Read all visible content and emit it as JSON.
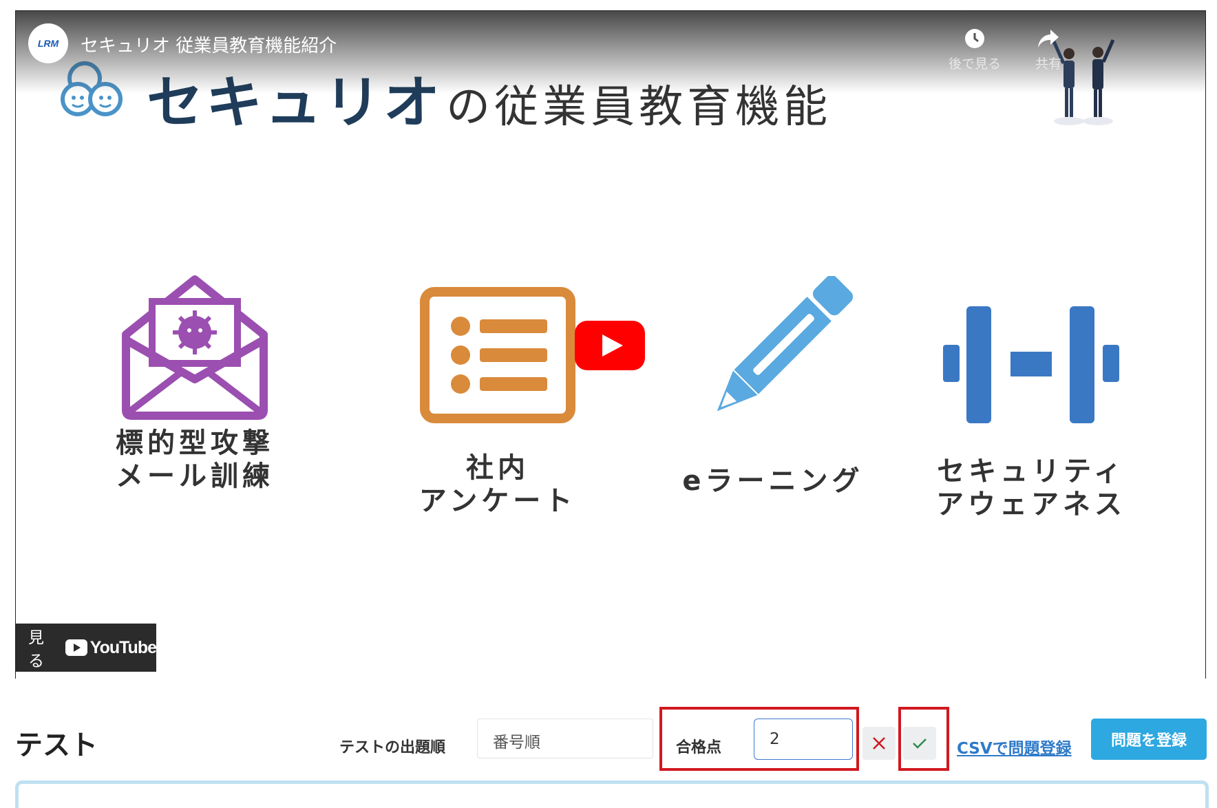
{
  "video": {
    "channel_avatar_text": "LRM",
    "title": "セキュリオ 従業員教育機能紹介",
    "watch_later_label": "後で見る",
    "share_label": "共有",
    "hero_brand": "セキュリオ",
    "hero_suffix": "の従業員教育機能",
    "features": [
      {
        "line1": "標的型攻撃",
        "line2": "メール訓練",
        "icon": "envelope-virus-icon"
      },
      {
        "line1": "社内",
        "line2": "アンケート",
        "icon": "checklist-icon"
      },
      {
        "line1": "eラーニング",
        "line2": "",
        "icon": "pencil-icon"
      },
      {
        "line1": "セキュリティ",
        "line2": "アウェアネス",
        "icon": "dumbbell-icon"
      }
    ],
    "watch_on_label": "見る",
    "youtube_word": "YouTube"
  },
  "toolbar": {
    "section_title": "テスト",
    "order_label": "テストの出題順",
    "order_value": "番号順",
    "pass_label": "合格点",
    "pass_value": "2",
    "csv_link": "CSVで問題登録",
    "register_button": "問題を登録"
  },
  "colors": {
    "highlight": "#d0191f",
    "accent_blue": "#2ea8e0",
    "link_blue": "#2e7ac9",
    "envelope_purple": "#9b4fb0",
    "checklist_orange": "#d98a3a",
    "pencil_blue": "#5aa9e0",
    "dumbbell_blue": "#3a78c4",
    "youtube_red": "#ff0000"
  }
}
